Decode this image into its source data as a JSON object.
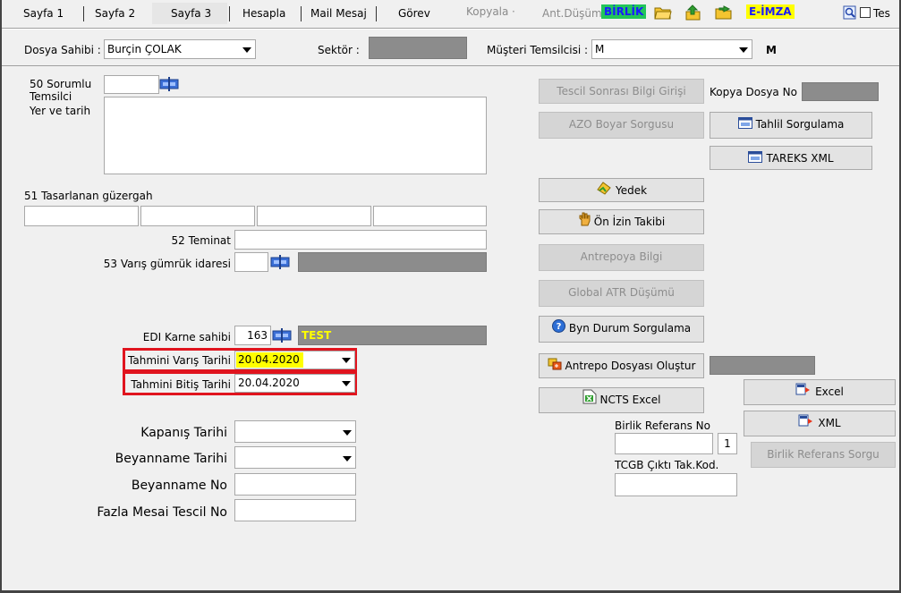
{
  "toolbar": {
    "sayfa1": "Sayfa 1",
    "sayfa2": "Sayfa 2",
    "sayfa3": "Sayfa 3",
    "hesapla": "Hesapla",
    "mail_mesaj": "Mail Mesaj",
    "gorev": "Görev",
    "kopyala": "Kopyala",
    "ant_dusum": "Ant.Düşüm",
    "birlik": "BİRLİK",
    "e_imza": "E-İMZA",
    "tes": "Tes"
  },
  "header": {
    "dosya_sahibi_label": "Dosya Sahibi :",
    "dosya_sahibi_value": "Burçin ÇOLAK",
    "sektor_label": "Sektör :",
    "musteri_temsilcisi_label": "Müşteri Temsilcisi :",
    "musteri_temsilcisi_value": "M",
    "musteri_temsilcisi_suffix": "M"
  },
  "left": {
    "sorumlu_label_1": "50 Sorumlu",
    "sorumlu_label_2": "Temsilci",
    "yer_tarih_label": "Yer ve tarih",
    "guzergah_label": "51 Tasarlanan güzergah",
    "teminat_label": "52 Teminat",
    "varis_gumruk_label": "53 Varış gümrük idaresi",
    "edi_karne_label": "EDI Karne sahibi",
    "edi_karne_value": "163",
    "test_badge": "TEST",
    "tahmini_varis_label": "Tahmini Varış Tarihi",
    "tahmini_varis_value": "20.04.2020",
    "tahmini_bitis_label": "Tahmini Bitiş Tarihi",
    "tahmini_bitis_value": "20.04.2020",
    "kapanis_label": "Kapanış Tarihi",
    "beyanname_tarihi_label": "Beyanname Tarihi",
    "beyanname_no_label": "Beyanname No",
    "fazla_mesai_label": "Fazla Mesai Tescil No"
  },
  "right": {
    "tescil_sonrasi": "Tescil Sonrası Bilgi Girişi",
    "kopya_dosya_no": "Kopya Dosya No",
    "azo_boyar": "AZO Boyar Sorgusu",
    "tahlil_sorgulama": "Tahlil Sorgulama",
    "tareks_xml": "TAREKS XML",
    "yedek": "Yedek",
    "on_izin": "Ön İzin Takibi",
    "antrepoya_bilgi": "Antrepoya Bilgi",
    "global_atr": "Global ATR Düşümü",
    "byn_durum": "Byn Durum Sorgulama",
    "antrepo_dosyasi": "Antrepo Dosyası Oluştur",
    "ncts_excel": "NCTS Excel",
    "excel": "Excel",
    "xml": "XML",
    "birlik_referans_no": "Birlik Referans No",
    "birlik_referans_count": "1",
    "birlik_referans_sorgu": "Birlik Referans Sorgu",
    "tcgb_cikti": "TCGB Çıktı Tak.Kod."
  },
  "colors": {
    "birlik_bg": "#22c55a",
    "birlik_fg": "#1a1aff",
    "eimza_bg": "#ffff00",
    "highlight": "#ffff00",
    "red_box": "#e0141e",
    "gray_field": "#8c8c8c"
  }
}
